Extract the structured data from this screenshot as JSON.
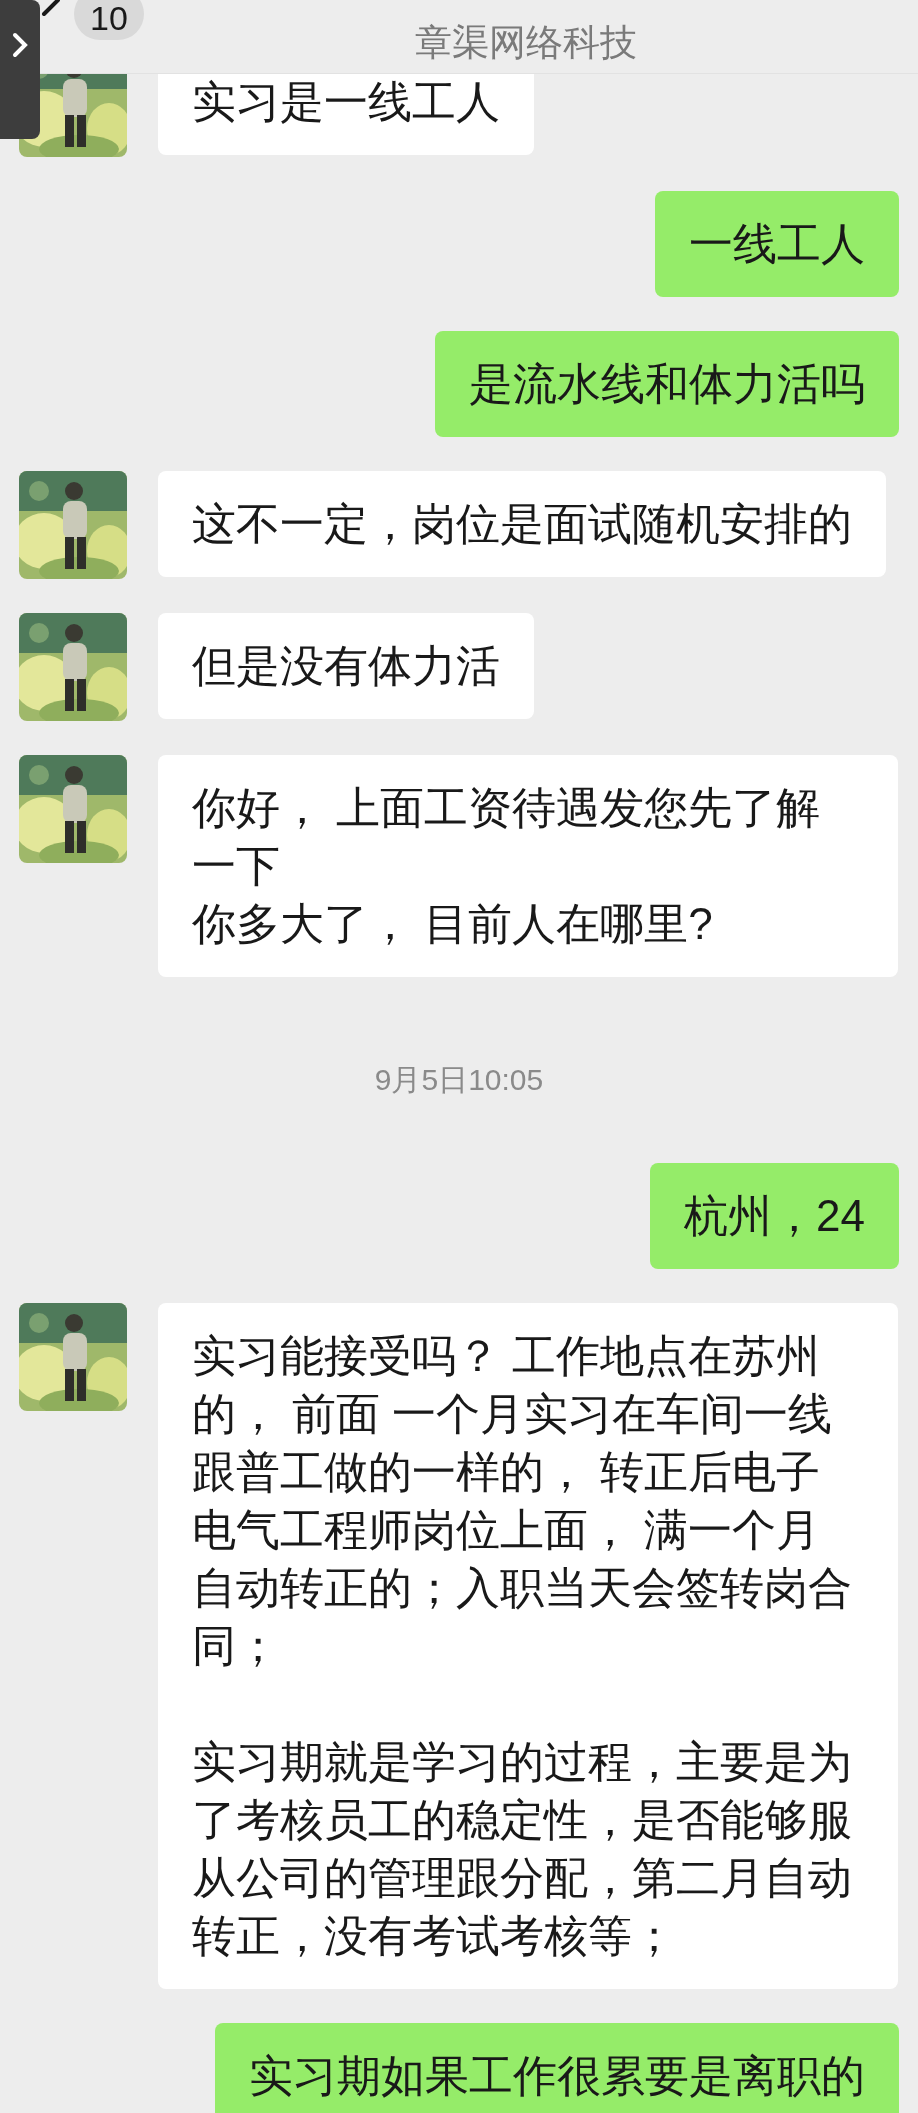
{
  "header": {
    "unread_count": "10",
    "subtitle": "章渠网络科技"
  },
  "messages": [
    {
      "kind": "received",
      "text": "实习是一线工人"
    },
    {
      "kind": "sent",
      "text": "一线工人"
    },
    {
      "kind": "sent",
      "text": "是流水线和体力活吗"
    },
    {
      "kind": "received",
      "text": "这不一定，岗位是面试随机安排的"
    },
    {
      "kind": "received",
      "text": "但是没有体力活"
    },
    {
      "kind": "received",
      "lines": [
        "你好， 上面工资待遇发您先了解一下",
        "你多大了， 目前人在哪里?"
      ]
    },
    {
      "kind": "time",
      "text": "9月5日10:05"
    },
    {
      "kind": "sent",
      "text": "杭州，24"
    },
    {
      "kind": "received",
      "paragraphs": [
        "实习能接受吗？ 工作地点在苏州的， 前面 一个月实习在车间一线跟普工做的一样的， 转正后电子电气工程师岗位上面， 满一个月自动转正的；入职当天会签转岗合同；",
        "实习期就是学习的过程，主要是为了考核员工的稳定性，是否能够服从公司的管理跟分配，第二月自动转正，没有考试考核等；"
      ]
    },
    {
      "kind": "sent",
      "text": "实习期如果工作很累要是离职的"
    }
  ]
}
